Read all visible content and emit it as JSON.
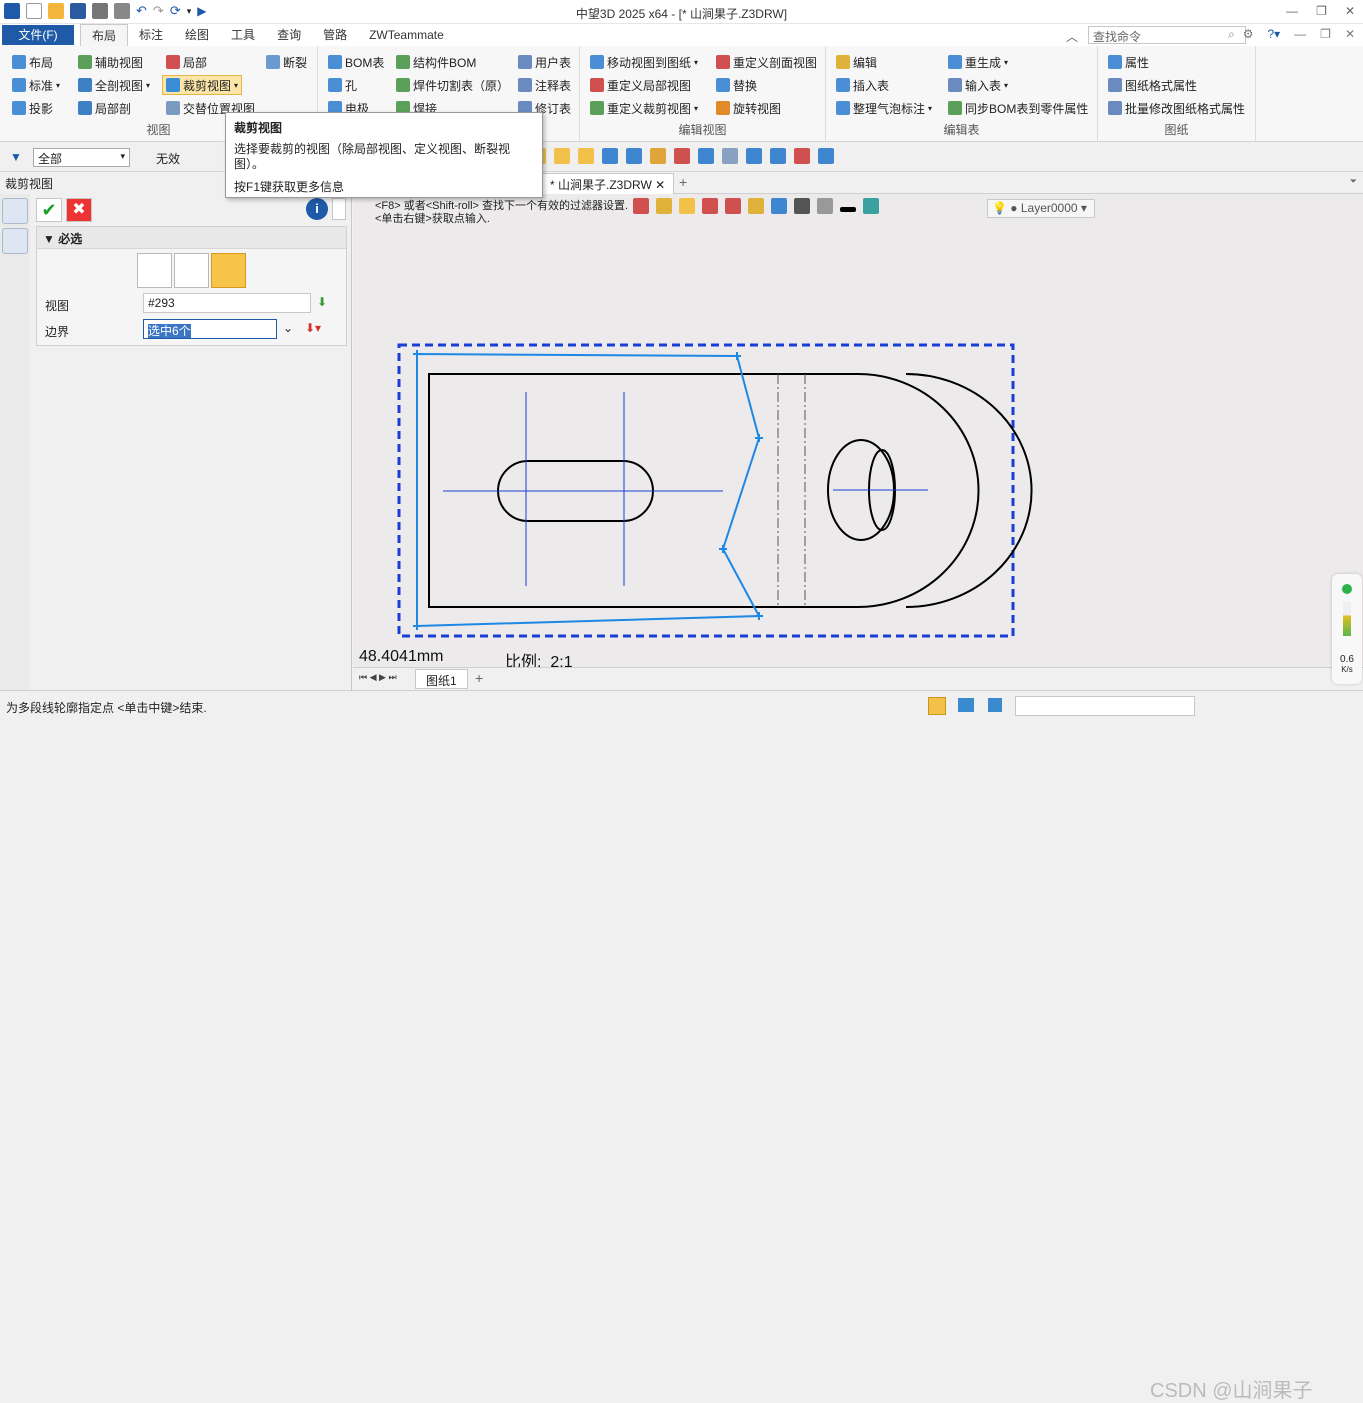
{
  "window": {
    "title": "中望3D 2025 x64 - [* 山涧果子.Z3DRW]"
  },
  "menu": {
    "file": "文件(F)",
    "tabs": [
      "布局",
      "标注",
      "绘图",
      "工具",
      "查询",
      "管路",
      "ZWTeammate"
    ],
    "search_placeholder": "查找命令"
  },
  "ribbon": {
    "view_group": {
      "label": "视图",
      "buttons": [
        "布局",
        "辅助视图",
        "局部",
        "断裂",
        "标准",
        "全剖视图",
        "裁剪视图",
        "投影",
        "局部剖",
        "交替位置视图"
      ]
    },
    "table_group": {
      "buttons": [
        "BOM表",
        "结构件BOM",
        "用户表",
        "孔",
        "焊件切割表（原）",
        "注释表",
        "电极",
        "焊接",
        "修订表"
      ]
    },
    "edit_view_group": {
      "label": "编辑视图",
      "buttons": [
        "移动视图到图纸",
        "重定义剖面视图",
        "重定义局部视图",
        "替换",
        "重定义裁剪视图",
        "旋转视图"
      ]
    },
    "edit_table_group": {
      "label": "编辑表",
      "buttons": [
        "编辑",
        "重生成",
        "插入表",
        "输入表",
        "整理气泡标注",
        "同步BOM表到零件属性"
      ]
    },
    "sheet_group": {
      "label": "图纸",
      "buttons": [
        "属性",
        "图纸格式属性",
        "批量修改图纸格式属性"
      ]
    }
  },
  "tooltip": {
    "title": "裁剪视图",
    "desc": "选择要裁剪的视图（除局部视图、定义视图、断裂视图）。",
    "help": "按F1键获取更多信息"
  },
  "toolbar": {
    "filter": "全部",
    "invalid": "无效"
  },
  "panel": {
    "title": "裁剪视图",
    "section": "必选",
    "view_label": "视图",
    "view_value": "#293",
    "boundary_label": "边界",
    "boundary_value": "选中6个"
  },
  "document": {
    "tab": "* 山涧果子.Z3DRW"
  },
  "canvas": {
    "hint_line1": "<F8> 或者<Shift-roll> 查找下一个有效的过滤器设置.",
    "hint_line2": "<单击右键>获取点输入.",
    "layer": "Layer0000",
    "dimension": "48.4041mm",
    "scale_label": "比例:",
    "scale_value": "2:1"
  },
  "sheet": {
    "tab": "图纸1"
  },
  "status": {
    "message": "为多段线轮廓指定点 <单击中键>结束.",
    "speed": "0.6",
    "speed_unit": "K/s"
  },
  "watermark": "CSDN @山涧果子",
  "colors": {
    "accent": "#1e5aa8",
    "crop_boundary": "#1e88e5",
    "drawing_frame": "#1a3dd6"
  }
}
